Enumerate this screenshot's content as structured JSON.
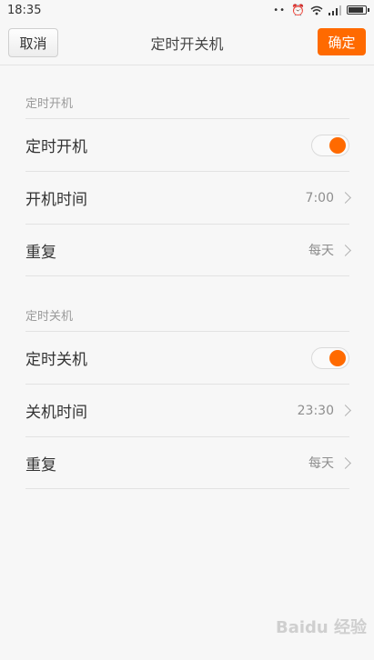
{
  "status_bar": {
    "time": "18:35",
    "dots": "••",
    "alarm_icon": "alarm-clock-icon",
    "wifi_icon": "wifi-icon",
    "signal_icon": "signal-icon",
    "battery_icon": "battery-icon"
  },
  "header": {
    "cancel_label": "取消",
    "title": "定时开关机",
    "confirm_label": "确定",
    "accent_color": "#ff6a00"
  },
  "sections": [
    {
      "header": "定时开机",
      "rows": [
        {
          "label": "定时开机",
          "toggle_on": true
        },
        {
          "label": "开机时间",
          "value": "7:00"
        },
        {
          "label": "重复",
          "value": "每天"
        }
      ]
    },
    {
      "header": "定时关机",
      "rows": [
        {
          "label": "定时关机",
          "toggle_on": true
        },
        {
          "label": "关机时间",
          "value": "23:30"
        },
        {
          "label": "重复",
          "value": "每天"
        }
      ]
    }
  ],
  "watermark": "Baidu 经验"
}
